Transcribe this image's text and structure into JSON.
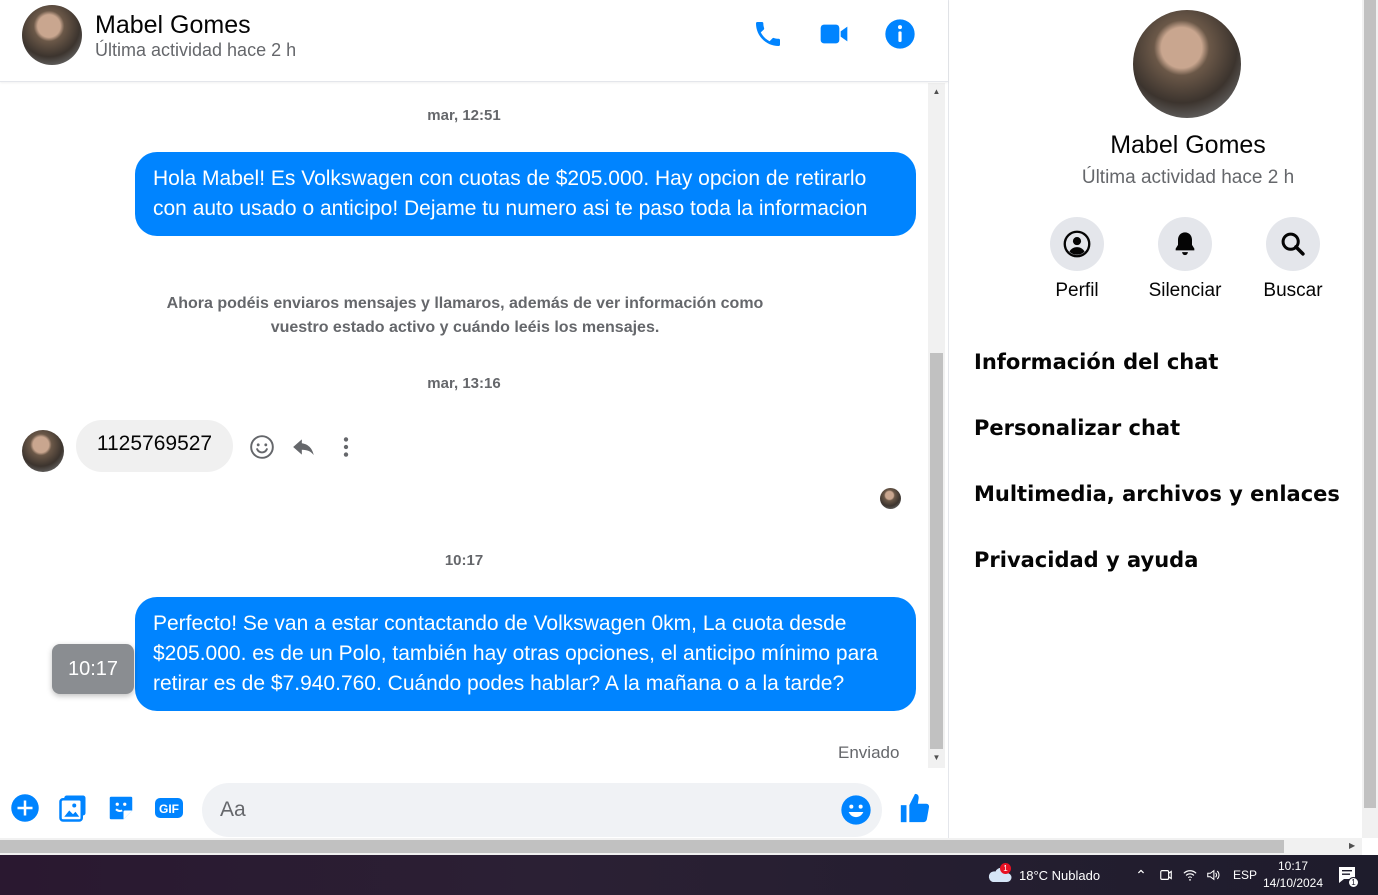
{
  "contact": {
    "name": "Mabel Gomes",
    "status": "Última actividad hace 2 h"
  },
  "header": {
    "icons": [
      "phone-icon",
      "video-icon",
      "info-icon"
    ]
  },
  "messages": {
    "ts1": "mar, 12:51",
    "out1": "Hola Mabel! Es Volkswagen con cuotas de $205.000. Hay opcion de retirarlo con auto usado o anticipo! Dejame tu numero asi te paso toda la informacion",
    "notice": "Ahora podéis enviaros mensajes y llamaros, además de ver información como vuestro estado activo y cuándo leéis los mensajes.",
    "ts2": "mar, 13:16",
    "in1": "1125769527",
    "ts3": "10:17",
    "out2": "Perfecto!  Se van a estar contactando de Volkswagen 0km, La cuota desde $205.000. es de un Polo, también hay otras opciones, el anticipo mínimo para retirar es de $7.940.760. Cuándo podes hablar? A la mañana o a la tarde?",
    "tooltip": "10:17",
    "sent": "Enviado"
  },
  "composer": {
    "placeholder": "Aa"
  },
  "side": {
    "actions": [
      "Perfil",
      "Silenciar",
      "Buscar"
    ],
    "menu": [
      "Información del chat",
      "Personalizar chat",
      "Multimedia, archivos y enlaces",
      "Privacidad y ayuda"
    ]
  },
  "taskbar": {
    "weather": "18°C  Nublado",
    "weather_badge": "1",
    "lang": "ESP",
    "time": "10:17",
    "date": "14/10/2024",
    "notif_count": "1"
  },
  "colors": {
    "accent": "#0084ff",
    "bubble_in": "#f0f0f0",
    "muted": "#65676b"
  }
}
